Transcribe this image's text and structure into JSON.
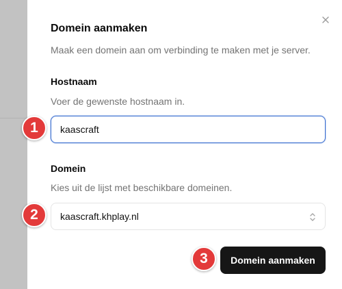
{
  "dialog": {
    "title": "Domein aanmaken",
    "description": "Maak een domein aan om verbinding te maken met je server."
  },
  "hostname": {
    "label": "Hostnaam",
    "hint": "Voer de gewenste hostnaam in.",
    "value": "kaascraft"
  },
  "domain": {
    "label": "Domein",
    "hint": "Kies uit de lijst met beschikbare domeinen.",
    "selected": "kaascraft.khplay.nl"
  },
  "submit_label": "Domein aanmaken",
  "steps": [
    "1",
    "2",
    "3"
  ],
  "colors": {
    "step_badge": "#e33a3a",
    "primary_button": "#161616",
    "focus_ring": "#3b6fd0"
  },
  "icons": [
    "close-icon",
    "chevron-up-down-icon"
  ]
}
